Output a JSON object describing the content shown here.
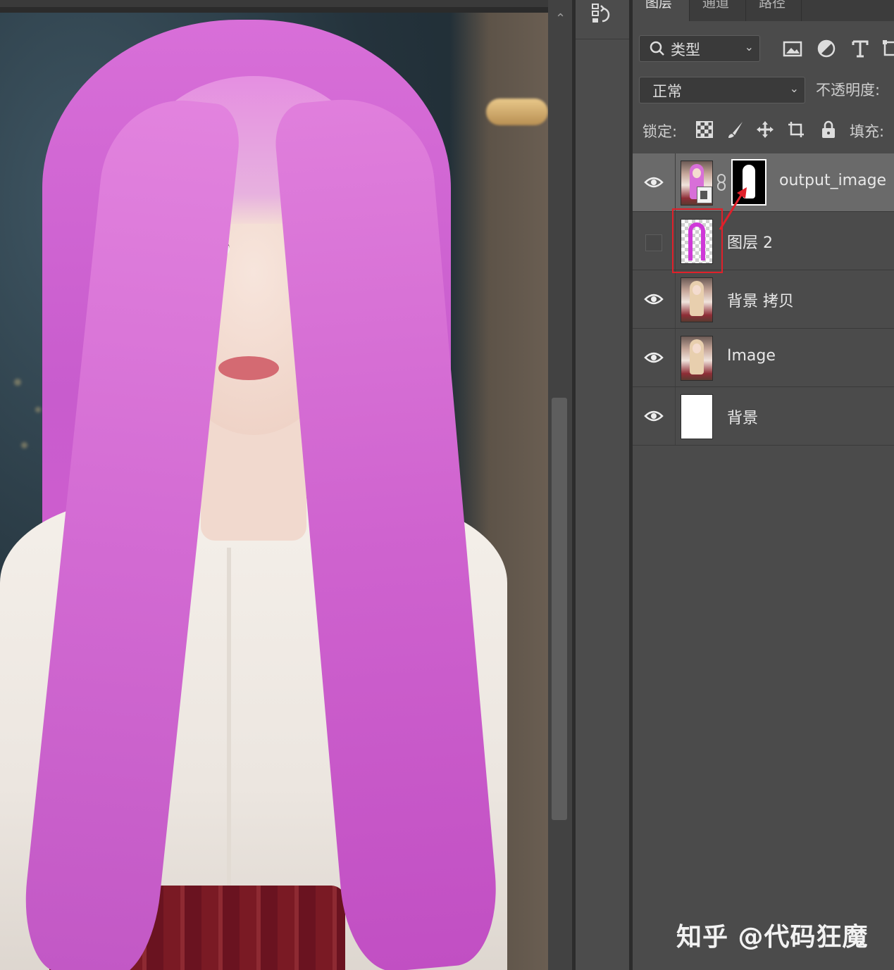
{
  "panel": {
    "tabs": [
      {
        "label": "图层",
        "active": true
      },
      {
        "label": "通道",
        "active": false
      },
      {
        "label": "路径",
        "active": false
      }
    ],
    "filter": {
      "label": "类型",
      "icons": [
        "image-filter-icon",
        "adjustment-filter-icon",
        "type-filter-icon",
        "shape-filter-icon"
      ]
    },
    "blend_mode": "正常",
    "opacity_label": "不透明度:",
    "lock_label": "锁定:",
    "lock_icons": [
      "lock-transparent-icon",
      "lock-paint-icon",
      "lock-move-icon",
      "lock-artboard-icon",
      "lock-all-icon"
    ],
    "fill_label": "填充:"
  },
  "layers": [
    {
      "name": "output_image",
      "visible": true,
      "selected": true,
      "type": "smart-object-with-mask"
    },
    {
      "name": "图层 2",
      "visible": false,
      "selected": false,
      "type": "hair-mask-layer"
    },
    {
      "name": "背景 拷贝",
      "visible": true,
      "selected": false,
      "type": "photo"
    },
    {
      "name": "Image",
      "visible": true,
      "selected": false,
      "type": "photo"
    },
    {
      "name": "背景",
      "visible": true,
      "selected": false,
      "type": "white"
    }
  ],
  "watermark": "知乎 @代码狂魔",
  "colors": {
    "hair": "#d86fd8",
    "highlight": "#e0202a",
    "panel_bg": "#4b4b4b"
  }
}
